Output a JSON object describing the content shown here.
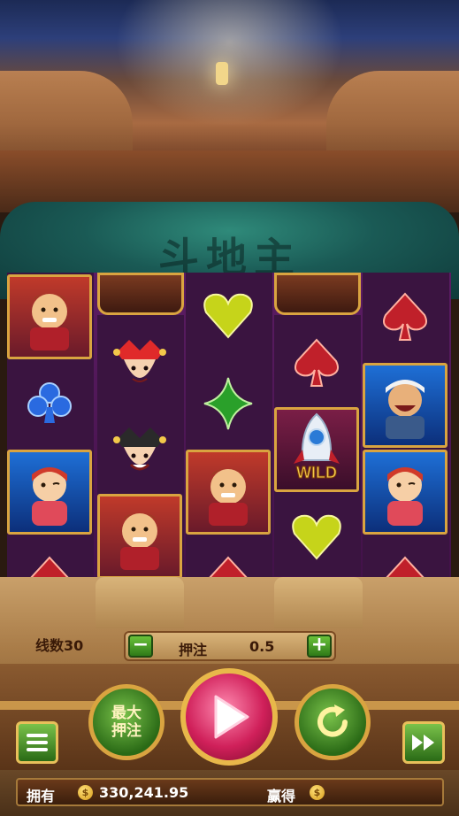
{
  "game": {
    "logo_text": "斗地主"
  },
  "reels": [
    [
      "man-red",
      "club-blue",
      "girl-red"
    ],
    [
      "joker-red",
      "joker-black",
      "man-red",
      "spade-red"
    ],
    [
      "heart-gold",
      "diamond-green",
      "man-red",
      "spade-red"
    ],
    [
      "spade-red",
      "wild-rocket",
      "heart-gold"
    ],
    [
      "spade-red",
      "man-white-cap",
      "girl-red",
      "spade-red"
    ]
  ],
  "wild_label": "WILD",
  "controls": {
    "lines_label": "线数",
    "lines_value": "30",
    "minus_label": "−",
    "plus_label": "+",
    "bet_label": "押注",
    "bet_value": "0.5",
    "max_bet_label_line1": "最大",
    "max_bet_label_line2": "押注"
  },
  "status": {
    "balance_label": "拥有",
    "balance_value": "330,241.95",
    "win_label": "赢得",
    "win_value": "",
    "coin_symbol": "$"
  },
  "colors": {
    "board_purple": "#4a1650",
    "frame_gold": "#d9a440",
    "button_green": "#4a9a28",
    "spin_pink": "#d0205a"
  }
}
